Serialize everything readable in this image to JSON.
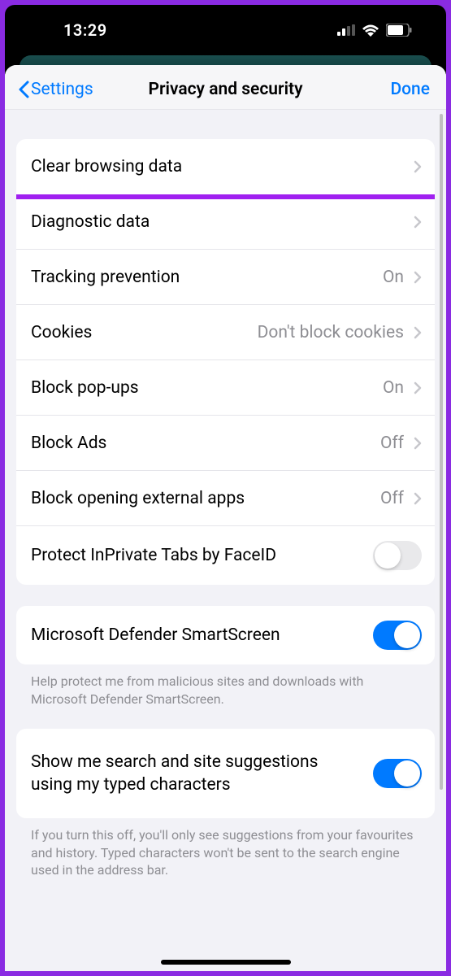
{
  "statusbar": {
    "time": "13:29"
  },
  "nav": {
    "back_label": "Settings",
    "title": "Privacy and security",
    "done_label": "Done"
  },
  "group1": {
    "items": [
      {
        "label": "Clear browsing data",
        "value": "",
        "chevron": true,
        "highlighted": true
      },
      {
        "label": "Diagnostic data",
        "value": "",
        "chevron": true
      },
      {
        "label": "Tracking prevention",
        "value": "On",
        "chevron": true
      },
      {
        "label": "Cookies",
        "value": "Don't block cookies",
        "chevron": true
      },
      {
        "label": "Block pop-ups",
        "value": "On",
        "chevron": true
      },
      {
        "label": "Block Ads",
        "value": "Off",
        "chevron": true
      },
      {
        "label": "Block opening external apps",
        "value": "Off",
        "chevron": true
      },
      {
        "label": "Protect InPrivate Tabs by FaceID",
        "toggle": false
      }
    ]
  },
  "group2": {
    "label": "Microsoft Defender SmartScreen",
    "toggle": true,
    "footer": "Help protect me from malicious sites and downloads with Microsoft Defender SmartScreen."
  },
  "group3": {
    "label": "Show me search and site suggestions using my typed characters",
    "toggle": true,
    "footer": "If you turn this off, you'll only see suggestions from your favourites and history. Typed characters won't be sent to the search engine used in the address bar."
  }
}
